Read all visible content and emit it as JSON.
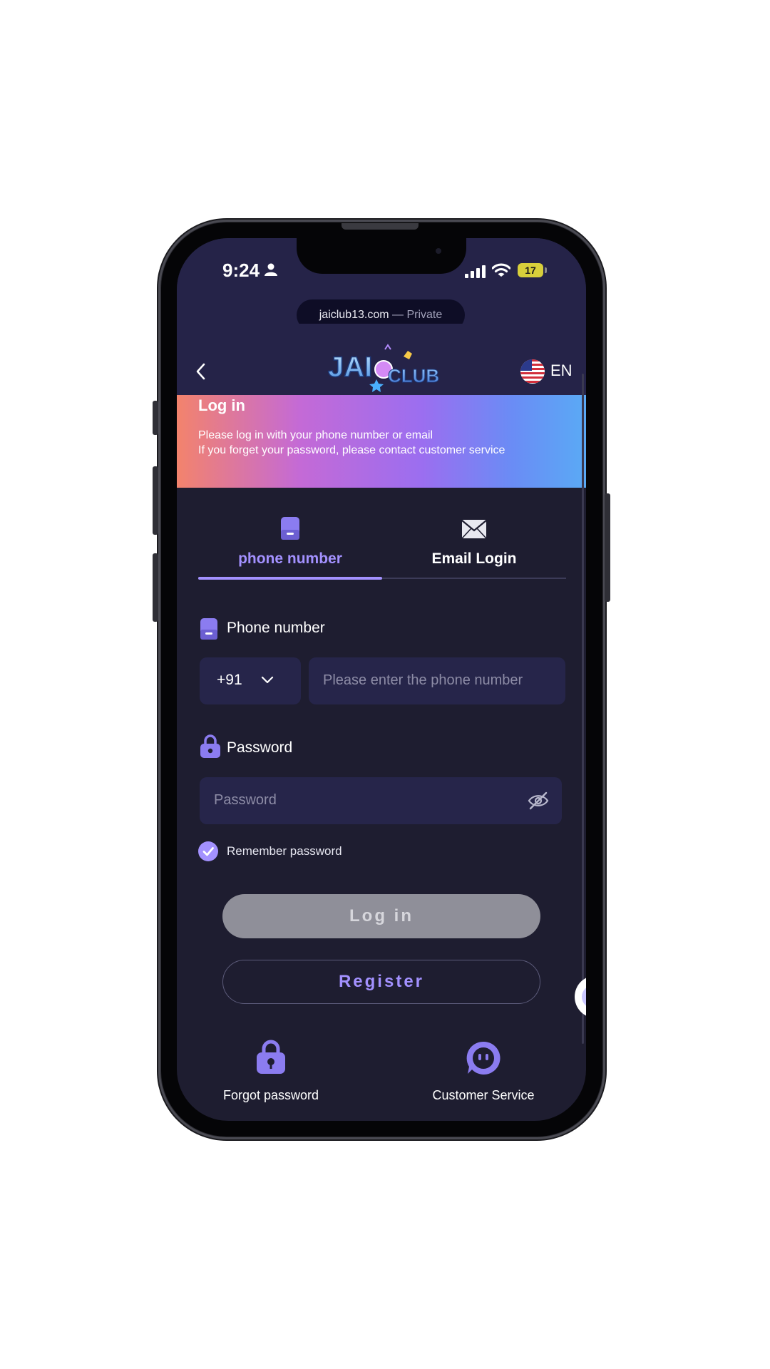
{
  "status_bar": {
    "time": "9:24",
    "battery": "17"
  },
  "browser": {
    "domain": "jaiclub13.com",
    "mode": "— Private"
  },
  "header": {
    "logo_text": "JAICLUB",
    "language": "EN"
  },
  "banner": {
    "title": "Log in",
    "line1": "Please log in with your phone number or email",
    "line2": "If you forget your password, please contact customer service"
  },
  "tabs": [
    {
      "label": "phone number",
      "active": true
    },
    {
      "label": "Email Login",
      "active": false
    }
  ],
  "form": {
    "phone_label": "Phone number",
    "country_code": "+91",
    "phone_placeholder": "Please enter the phone number",
    "password_label": "Password",
    "password_placeholder": "Password",
    "remember_label": "Remember password",
    "remember_checked": true
  },
  "buttons": {
    "login": "Log in",
    "register": "Register"
  },
  "bottom_links": [
    {
      "label": "Forgot password",
      "icon": "lock-icon"
    },
    {
      "label": "Customer Service",
      "icon": "support-icon"
    }
  ],
  "colors": {
    "background": "#1e1d30",
    "accent": "#a391ff",
    "input_bg": "#26254a",
    "login_disabled": "#8f8f99"
  }
}
